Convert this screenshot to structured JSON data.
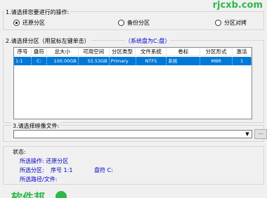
{
  "watermark": "rjcxb.com",
  "section1": {
    "title": "1.请选择您要进行的操作:",
    "options": [
      {
        "label": "还原分区",
        "selected": true
      },
      {
        "label": "备份分区",
        "selected": false
      },
      {
        "label": "分区对拷",
        "selected": false
      }
    ]
  },
  "section2": {
    "title": "2.请选择分区（用鼠标左键单击）",
    "hint": "（系统盘为C:盘）",
    "columns": [
      "序号",
      "盘符",
      "总大小",
      "可用空间",
      "分区类型",
      "文件系统",
      "卷标",
      "分区形式",
      "激活"
    ],
    "rows": [
      {
        "index": "1:1",
        "drive": "C:",
        "total": "100.00GB",
        "free": "55.53GB",
        "type": "Primary",
        "fs": "NTFS",
        "label": "系统",
        "style": "MBR",
        "active": "1"
      }
    ]
  },
  "section3": {
    "title": "3.请选择映像文件:",
    "value": "",
    "browse_label": "..."
  },
  "status": {
    "title": "状态:",
    "operation": "所选操作: 还原分区",
    "partition_prefix": "所选分区:",
    "partition_index": "序号 1:1",
    "partition_drive": "盘符 C:",
    "path": "所选路径/文件:"
  },
  "logo_text": "软件邦",
  "colors": {
    "accent": "#0078d7",
    "status_text": "#0000c8",
    "brand_green": "#2db84a"
  }
}
